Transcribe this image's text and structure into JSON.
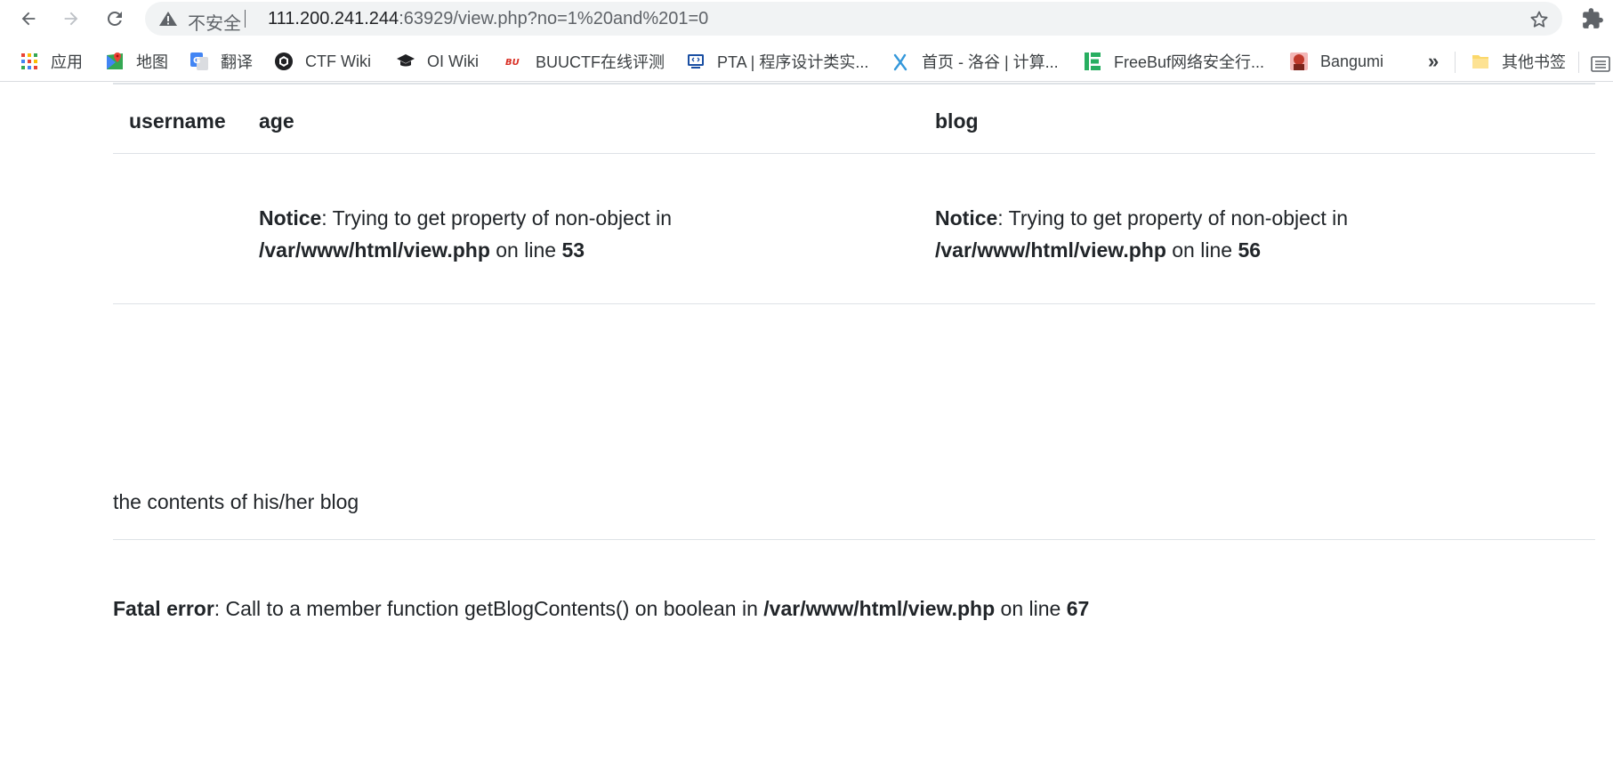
{
  "browser": {
    "security_label": "不安全",
    "url_host": "111.200.241.244",
    "url_rest": ":63929/view.php?no=1%20and%201=0"
  },
  "bookmarks": {
    "items": [
      {
        "label": "应用",
        "icon": "apps-grid-icon"
      },
      {
        "label": "地图",
        "icon": "maps-icon"
      },
      {
        "label": "翻译",
        "icon": "translate-icon"
      },
      {
        "label": "CTF Wiki",
        "icon": "ctf-wiki-icon"
      },
      {
        "label": "OI Wiki",
        "icon": "graduation-cap-icon"
      },
      {
        "label": "BUUCTF在线评测",
        "icon": "buuctf-icon"
      },
      {
        "label": "PTA | 程序设计类实...",
        "icon": "pta-icon"
      },
      {
        "label": "首页 - 洛谷 | 计算...",
        "icon": "luogu-icon"
      },
      {
        "label": "FreeBuf网络安全行...",
        "icon": "freebuf-icon"
      },
      {
        "label": "Bangumi",
        "icon": "bangumi-icon"
      }
    ],
    "more": "»",
    "other": "其他书签"
  },
  "table": {
    "headers": {
      "username": "username",
      "age": "age",
      "blog": "blog"
    },
    "age_notice": {
      "label": "Notice",
      "message": ": Trying to get property of non-object in",
      "path": "/var/www/html/view.php",
      "on_line": " on line ",
      "line": "53"
    },
    "blog_notice": {
      "label": "Notice",
      "message": ": Trying to get property of non-object in",
      "path": "/var/www/html/view.php",
      "on_line": " on line ",
      "line": "56"
    }
  },
  "contents_text": "the contents of his/her blog",
  "fatal": {
    "label": "Fatal error",
    "message": ": Call to a member function getBlogContents() on boolean in ",
    "path": "/var/www/html/view.php",
    "on_line": " on line ",
    "line": "67"
  },
  "colors": {
    "omnibox_bg": "#f1f3f4",
    "rule": "#dee2e6",
    "text": "#212529"
  }
}
